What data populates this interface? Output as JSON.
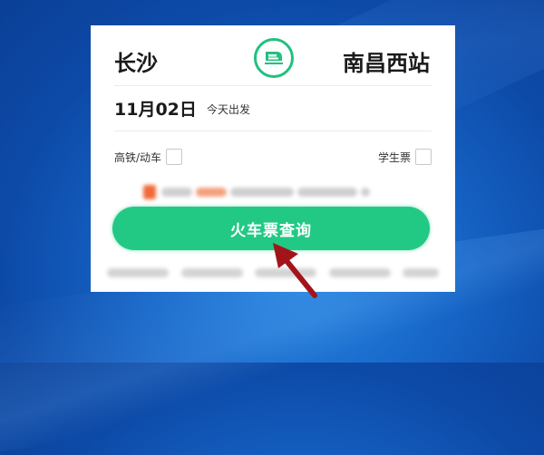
{
  "route": {
    "from_city": "长沙",
    "to_city": "南昌西站",
    "swap_icon": "train-swap-icon"
  },
  "date": {
    "value": "11月02日",
    "weekday": "今天出发"
  },
  "options": {
    "high_speed_label": "高铁/动车",
    "high_speed_checked": false,
    "student_label": "学生票",
    "student_checked": false
  },
  "search_button": {
    "label": "火车票查询"
  },
  "colors": {
    "accent": "#22c985",
    "annotation_arrow": "#a3141a",
    "background": "#1767c9"
  }
}
